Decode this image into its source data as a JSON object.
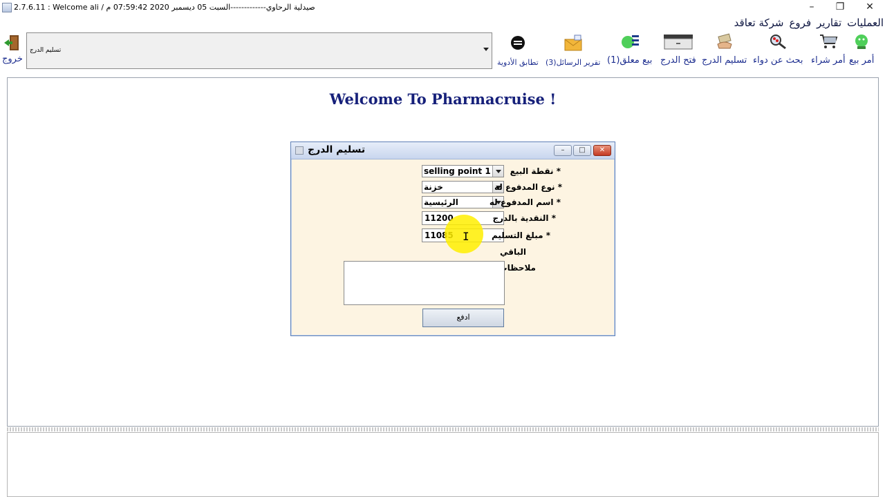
{
  "window": {
    "title": "2.7.6.11 : Welcome ali / صيدلية الرحاوي-------------السبت 05 ديسمبر 2020 07:59:42 م"
  },
  "menu": [
    "العمليات",
    "تقارير",
    "فروع",
    "شركة تعاقد"
  ],
  "toolbar": {
    "items": [
      {
        "label": "أمر بيع",
        "icon": "sell-order-icon"
      },
      {
        "label": "أمر شراء",
        "icon": "cart-icon"
      },
      {
        "label": "بحث عن دواء",
        "icon": "search-medicine-icon"
      },
      {
        "label": "تسليم الدرج",
        "icon": "hand-over-drawer-icon"
      },
      {
        "label": "فتح الدرج",
        "icon": "cash-drawer-icon"
      },
      {
        "label": "بيع معلق(1)",
        "icon": "pending-sale-icon"
      },
      {
        "label": "تقرير الرسائل(3)",
        "icon": "messages-icon"
      },
      {
        "label": "تطابق الأدوية",
        "icon": "match-icon"
      }
    ],
    "combo_value": "تسليم الدرج",
    "exit_label": "خروج"
  },
  "main": {
    "welcome": "Welcome To Pharmacruise !"
  },
  "dialog": {
    "title": "تسليم الدرج",
    "fields": {
      "selling_point": {
        "label": "نقطة البيع",
        "value": "selling point 1"
      },
      "payee_type": {
        "label": "نوع المدفوع له",
        "value": "خزنة"
      },
      "payee_name": {
        "label": "اسم المدفوع له",
        "value": "الرئيسية"
      },
      "cash_in_drawer": {
        "label": "النقدية بالدرج",
        "value": "11200"
      },
      "delivery_amount": {
        "label": "مبلغ التسليم",
        "value": "11085"
      },
      "remaining": {
        "label": "الباقي"
      },
      "notes": {
        "label": "ملاحظات"
      }
    },
    "required_mark": "*",
    "pay_button": "ادفع"
  },
  "colors": {
    "accent": "#1c2d8f",
    "welcome": "#16207a",
    "dialog_bg": "#fdf4e2",
    "highlight": "#ffee00"
  }
}
